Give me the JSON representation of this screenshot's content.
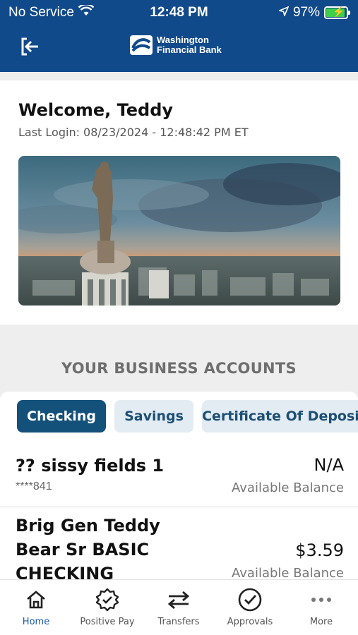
{
  "status_bar": {
    "carrier": "No Service",
    "time": "12:48 PM",
    "battery": "97%"
  },
  "header": {
    "brand_line1": "Washington",
    "brand_line2": "Financial Bank",
    "brand_color": "#114a8a"
  },
  "welcome": {
    "title": "Welcome, Teddy",
    "last_login": "Last Login: 08/23/2024 - 12:48:42 PM ET"
  },
  "accounts_section": {
    "title": "YOUR BUSINESS ACCOUNTS",
    "tabs": [
      {
        "label": "Checking",
        "active": true
      },
      {
        "label": "Savings",
        "active": false
      },
      {
        "label": "Certificate Of Deposit",
        "active": false
      }
    ]
  },
  "accounts": [
    {
      "name": "?? sissy fields 1",
      "number": "****841",
      "balance": "N/A",
      "balance_label": "Available Balance"
    },
    {
      "name_lines": [
        "Brig Gen Teddy",
        "Bear Sr BASIC",
        "CHECKING"
      ],
      "balance": "$3.59",
      "balance_label": "Available Balance"
    }
  ],
  "bottom_nav": [
    {
      "label": "Home",
      "icon": "home-icon",
      "active": true
    },
    {
      "label": "Positive Pay",
      "icon": "badge-check-icon",
      "active": false
    },
    {
      "label": "Transfers",
      "icon": "transfer-arrows-icon",
      "active": false
    },
    {
      "label": "Approvals",
      "icon": "check-circle-icon",
      "active": false
    },
    {
      "label": "More",
      "icon": "more-dots-icon",
      "active": false
    }
  ]
}
